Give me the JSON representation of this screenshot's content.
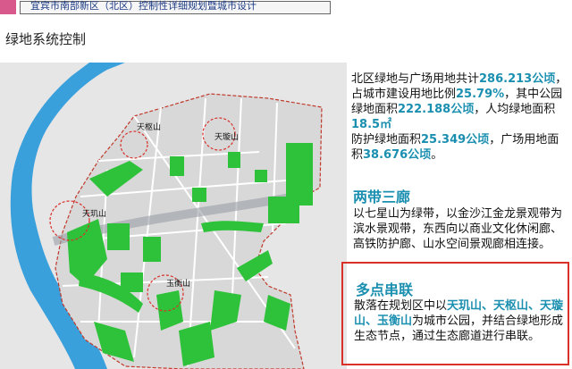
{
  "header": {
    "title": "宜宾市南部新区（北区）控制性详细规划暨城市设计"
  },
  "page_title": "绿地系统控制",
  "map": {
    "labels": {
      "tianshu": "天枢山",
      "tianxuan": "天璇山",
      "tianji": "天玑山",
      "yuheng": "玉衡山"
    }
  },
  "sec1": {
    "t1": "北区绿地与广场用地共计",
    "v1": "286.213公顷",
    "t2": "，占城市建设用地比例",
    "v2": "25.79%",
    "t3": "，其中公园绿地面积",
    "v3": "222.188公顷",
    "t4": "，人均绿地面积",
    "v4": "18.5㎡",
    "t5": "防护绿地面积",
    "v5": "25.349公顷",
    "t6": "，广场用地面积",
    "v6": "38.676公顷",
    "t7": "。"
  },
  "sec2": {
    "heading": "两带三廊",
    "body": "以七星山为绿带，以金沙江金龙景观带为滨水景观带，东西向以商业文化休闲廊、高铁防护廊、山水空间景观廊相连接。"
  },
  "sec3": {
    "heading": "多点串联",
    "t1": "散落在规划区中以",
    "v1": "天玑山、天枢山、天璇山、玉衡山",
    "t2": "为城市公园，并结合绿地形成生态节点，通过生态廊道进行串联。"
  },
  "colors": {
    "accent": "#1b8fb0",
    "header_pink": "#d85a8c",
    "river": "#3aa0dc",
    "park": "#2ec23a",
    "frame": "#d9302a"
  }
}
